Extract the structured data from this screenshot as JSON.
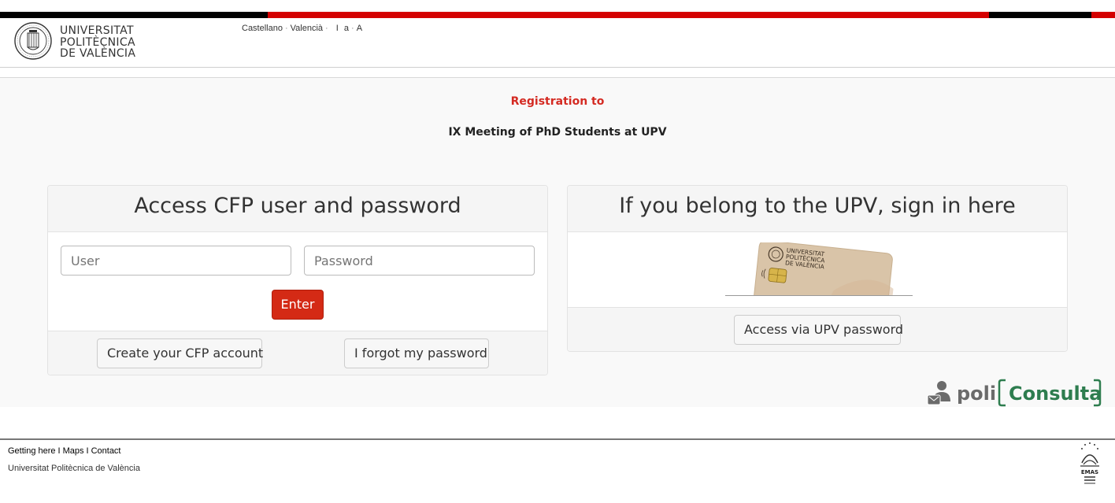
{
  "header": {
    "logo_lines": [
      "UNIVERSITAT",
      "POLITÈCNICA",
      "DE VALÈNCIA"
    ],
    "languages": [
      "Castellano",
      "Valencià"
    ],
    "font_size_controls": [
      "I",
      "a",
      "A"
    ]
  },
  "main": {
    "registration_to": "Registration to",
    "event_title": "IX Meeting of PhD Students at UPV"
  },
  "cfp_panel": {
    "title": "Access CFP user and password",
    "user_placeholder": "User",
    "password_placeholder": "Password",
    "enter_label": "Enter",
    "create_account_label": "Create your CFP account",
    "forgot_password_label": "I forgot my password"
  },
  "upv_panel": {
    "title": "If you belong to the UPV, sign in here",
    "card_text": [
      "UNIVERSITAT",
      "POLITÈCNICA",
      "DE VALÈNCIA"
    ],
    "access_label": "Access via UPV password"
  },
  "policonsulta": {
    "poli": "poli",
    "consulta": "Consulta"
  },
  "footer": {
    "links": [
      "Getting here",
      "Maps",
      "Contact"
    ],
    "separator": "I",
    "university_name": "Universitat Politècnica de València",
    "emas_label": "EMAS"
  },
  "colors": {
    "brand_red": "#d42a15",
    "heading_red": "#d42a22",
    "policonsulta_green": "#2e7d4f",
    "policonsulta_gray": "#6b6b6b"
  }
}
